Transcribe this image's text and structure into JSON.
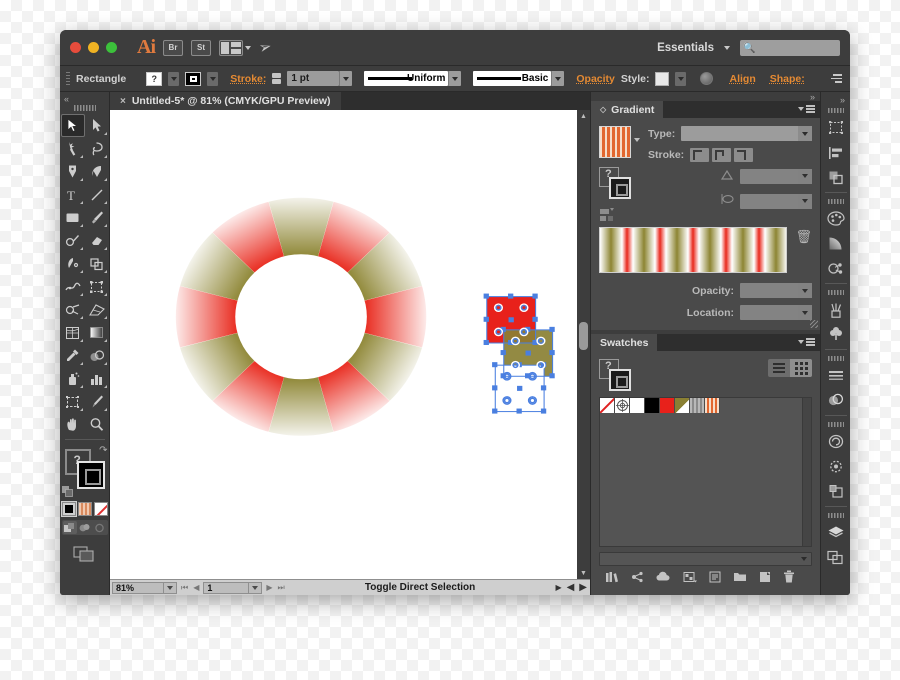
{
  "window": {
    "traffic_lights": [
      "close",
      "minimize",
      "zoom"
    ],
    "app_logo": "Ai",
    "bridge_button": "Br",
    "stock_button": "St",
    "arrange_documents": "arrange-documents",
    "rocket_icon": "rocket-icon",
    "workspace": "Essentials",
    "search_placeholder": ""
  },
  "control_bar": {
    "object_label": "Rectangle",
    "fill_swatch": "?",
    "stroke_swatch": "stroke",
    "stroke_label": "Stroke:",
    "stroke_weight": "1 pt",
    "stroke_profile": "Uniform",
    "brush_definition": "Basic",
    "opacity_label": "Opacity",
    "style_label": "Style:",
    "recolor_icon": "recolor-artwork-icon",
    "align_label": "Align",
    "shape_label": "Shape:",
    "more_options_icon": "panel-options-icon"
  },
  "toolbar": {
    "tools": [
      {
        "name": "selection-tool",
        "selected": true
      },
      {
        "name": "direct-selection-tool",
        "selected": false
      },
      {
        "name": "magic-wand-tool",
        "selected": false
      },
      {
        "name": "lasso-tool",
        "selected": false
      },
      {
        "name": "pen-tool",
        "selected": false
      },
      {
        "name": "curvature-tool",
        "selected": false
      },
      {
        "name": "type-tool",
        "selected": false
      },
      {
        "name": "line-segment-tool",
        "selected": false
      },
      {
        "name": "rectangle-tool",
        "selected": false
      },
      {
        "name": "paintbrush-tool",
        "selected": false
      },
      {
        "name": "pencil-tool",
        "selected": false
      },
      {
        "name": "eraser-tool",
        "selected": false
      },
      {
        "name": "rotate-tool",
        "selected": false
      },
      {
        "name": "scale-tool",
        "selected": false
      },
      {
        "name": "width-tool",
        "selected": false
      },
      {
        "name": "free-transform-tool",
        "selected": false
      },
      {
        "name": "shape-builder-tool",
        "selected": false
      },
      {
        "name": "perspective-grid-tool",
        "selected": false
      },
      {
        "name": "mesh-tool",
        "selected": false
      },
      {
        "name": "gradient-tool",
        "selected": false
      },
      {
        "name": "eyedropper-tool",
        "selected": false
      },
      {
        "name": "blend-tool",
        "selected": false
      },
      {
        "name": "symbol-sprayer-tool",
        "selected": false
      },
      {
        "name": "column-graph-tool",
        "selected": false
      },
      {
        "name": "artboard-tool",
        "selected": false
      },
      {
        "name": "slice-tool",
        "selected": false
      },
      {
        "name": "hand-tool",
        "selected": false
      },
      {
        "name": "zoom-tool",
        "selected": false
      }
    ],
    "fill_value": "?",
    "stroke_value": "black",
    "color_modes": [
      "color",
      "gradient",
      "none"
    ],
    "screen_modes": [
      "normal-screen-mode",
      "full-screen-menu-bar",
      "full-screen"
    ]
  },
  "document": {
    "tab_title": "Untitled-5* @ 81% (CMYK/GPU Preview)",
    "close_icon": "×"
  },
  "artwork": {
    "ring": {
      "name": "gradient-ring-shape",
      "gradient_colors": [
        "#ffffff",
        "#8d8533",
        "#ffffff",
        "#e8281c"
      ],
      "segments": 12
    },
    "squares": [
      {
        "name": "red-square",
        "color": "#e8211b"
      },
      {
        "name": "olive-square",
        "color": "#8a8033"
      },
      {
        "name": "white-square",
        "color": "#ffffff"
      }
    ]
  },
  "status_bar": {
    "zoom_level": "81%",
    "artboard_number": "1",
    "status_text": "Toggle Direct Selection",
    "first_icon": "first-artboard",
    "prev_icon": "previous-artboard",
    "next_icon": "next-artboard",
    "last_icon": "last-artboard"
  },
  "gradient_panel": {
    "title": "Gradient",
    "thumbnail": "gradient-thumbnail",
    "type_label": "Type:",
    "type_value": "",
    "stroke_label": "Stroke:",
    "stroke_options": [
      "stroke-within",
      "stroke-center",
      "stroke-outside"
    ],
    "angle_label": "",
    "angle_value": "",
    "aspect_label": "",
    "aspect_value": "",
    "opacity_label": "Opacity:",
    "opacity_value": "",
    "location_label": "Location:",
    "location_value": "",
    "delete_stop_icon": "trash-icon",
    "fill_indicator": "?",
    "gradient_colors": [
      "#ffffff",
      "#8d8533",
      "#ffffff",
      "#e8281c"
    ],
    "gradient_repeats": 8
  },
  "swatches_panel": {
    "title": "Swatches",
    "view_list_icon": "list-view-icon",
    "view_grid_icon": "grid-view-icon",
    "fill_indicator": "?",
    "swatches": [
      {
        "name": "none-swatch",
        "color": "none"
      },
      {
        "name": "registration-swatch",
        "color": "registration"
      },
      {
        "name": "white-swatch",
        "color": "#ffffff"
      },
      {
        "name": "black-swatch",
        "color": "#000000"
      },
      {
        "name": "red-swatch",
        "color": "#e8211b"
      },
      {
        "name": "olive-gradient-swatch",
        "color": "#8a8033"
      },
      {
        "name": "gray-stripe-pattern-swatch",
        "color": "#9a9a9a"
      },
      {
        "name": "orange-stripe-pattern-swatch",
        "color": "#e2672f"
      }
    ],
    "toolbar_icons": [
      "swatch-libraries-icon",
      "link-color-icon",
      "cc-library-icon",
      "show-swatch-kinds-icon",
      "swatch-options-icon",
      "new-color-group-icon",
      "new-swatch-icon",
      "delete-swatch-icon"
    ]
  },
  "dock": {
    "groups": [
      [
        "artboards-icon",
        "align-icon",
        "pathfinder-icon"
      ],
      [
        "color-icon",
        "gradient-icon",
        "color-guide-icon"
      ],
      [
        "brushes-icon",
        "symbols-icon"
      ],
      [
        "stroke-icon",
        "transparency-icon"
      ],
      [
        "cc-libraries-icon",
        "appearance-icon",
        "graphic-styles-icon"
      ],
      [
        "layers-icon",
        "artboards-panel-icon"
      ]
    ]
  },
  "colors": {
    "chrome": "#3d3d3d",
    "panel": "#4a4a4a",
    "accent_orange": "#e58a33",
    "canvas": "#ffffff",
    "status_bar": "#cfcfcf"
  }
}
